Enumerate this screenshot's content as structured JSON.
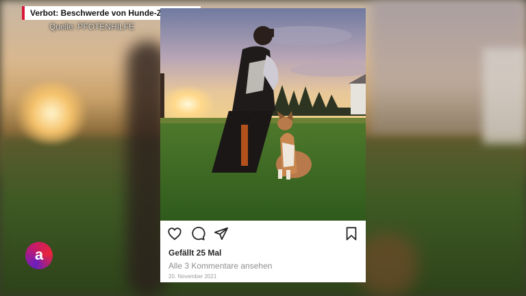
{
  "headline": "Verbot: Beschwerde von Hunde-Züchterin",
  "source": "Quelle: PFOTENHILFE",
  "post": {
    "likes": "Gefällt 25 Mal",
    "comments": "Alle 3 Kommentare ansehen",
    "date": "20. November 2021",
    "icons": [
      "heart-icon",
      "comment-icon",
      "share-icon",
      "bookmark-icon"
    ]
  },
  "channel_logo": {
    "letter": "a"
  },
  "colors": {
    "accent": "#d9163a",
    "card": "#ffffff"
  }
}
